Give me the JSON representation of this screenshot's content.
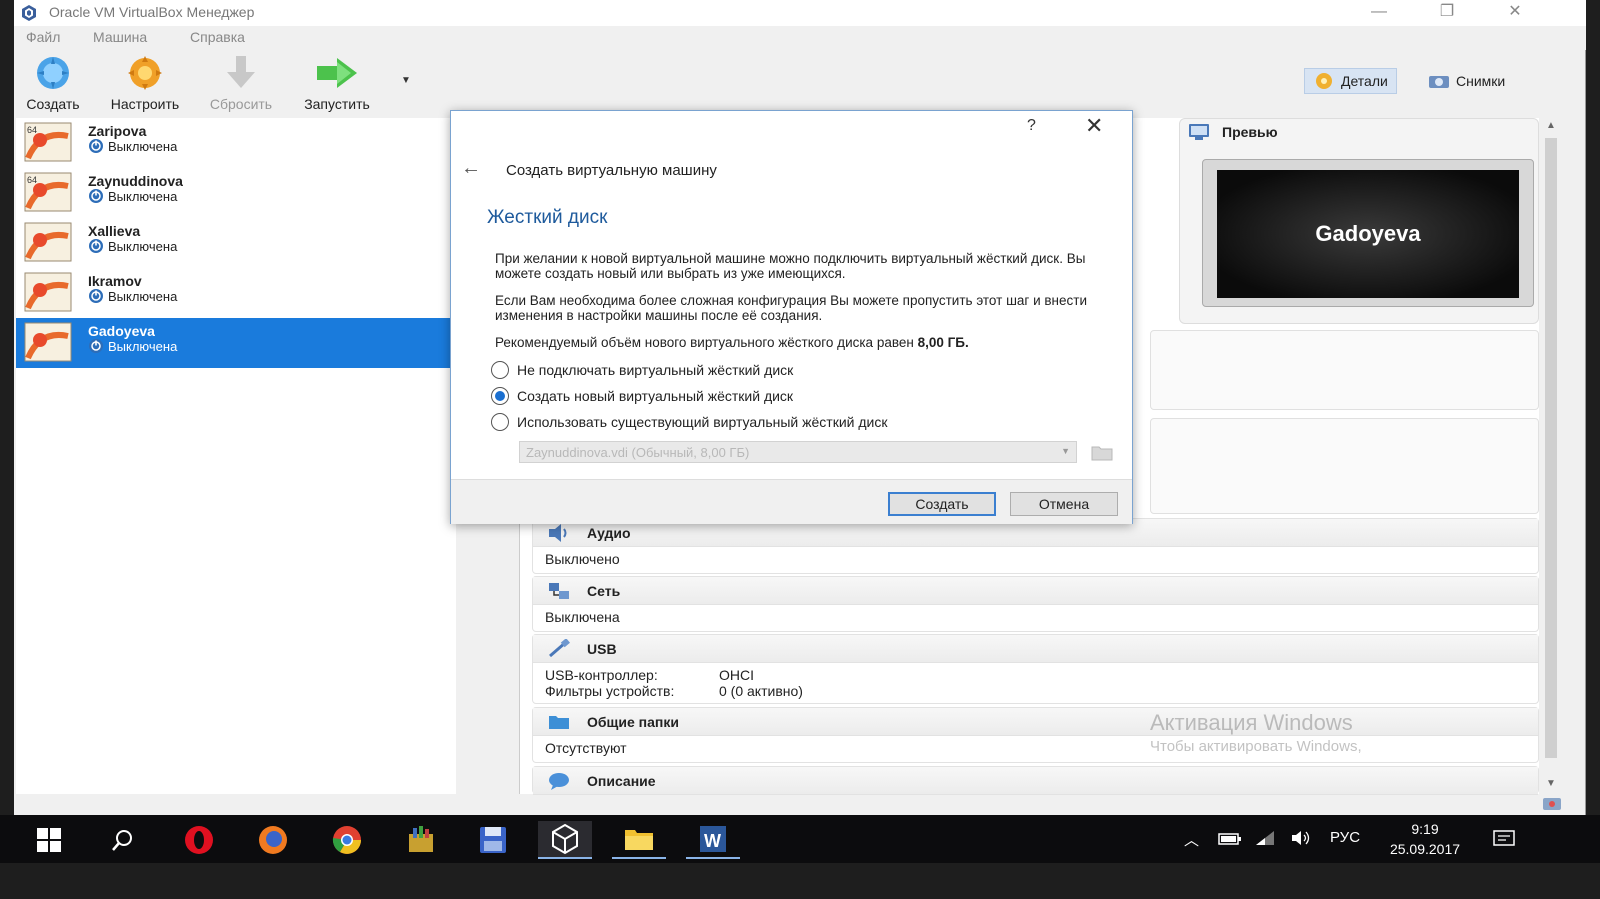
{
  "window": {
    "title": "Oracle VM VirtualBox Менеджер",
    "controls": {
      "minimize": "—",
      "restore": "❐",
      "close": "✕"
    }
  },
  "menu": [
    "Файл",
    "Машина",
    "Справка"
  ],
  "toolbar": {
    "create": "Создать",
    "settings": "Настроить",
    "discard": "Сбросить",
    "start": "Запустить",
    "details": "Детали",
    "snapshots": "Снимки"
  },
  "vms": [
    {
      "name": "Zaripova",
      "state": "Выключена",
      "badge": "64"
    },
    {
      "name": "Zaynuddinova",
      "state": "Выключена",
      "badge": "64"
    },
    {
      "name": "Xallieva",
      "state": "Выключена",
      "badge": ""
    },
    {
      "name": "Ikramov",
      "state": "Выключена",
      "badge": ""
    },
    {
      "name": "Gadoyeva",
      "state": "Выключена",
      "badge": ""
    }
  ],
  "preview": {
    "title": "Превью",
    "screen_text": "Gadoyeva"
  },
  "sections": {
    "audio": {
      "title": "Аудио",
      "value": "Выключено"
    },
    "network": {
      "title": "Сеть",
      "value": "Выключена"
    },
    "usb": {
      "title": "USB",
      "controller_label": "USB-контроллер:",
      "controller_value": "OHCI",
      "filters_label": "Фильтры устройств:",
      "filters_value": "0 (0 активно)"
    },
    "shared": {
      "title": "Общие папки",
      "value": "Отсутствуют"
    },
    "description": {
      "title": "Описание"
    }
  },
  "watermark": {
    "line1": "Активация Windows",
    "line2": "Чтобы активировать Windows,"
  },
  "dialog": {
    "help": "?",
    "close": "✕",
    "title": "Создать виртуальную машину",
    "heading": "Жесткий диск",
    "para1": "При желании к новой виртуальной машине можно подключить виртуальный жёсткий диск. Вы можете создать новый или выбрать из уже имеющихся.",
    "para2": "Если Вам необходима более сложная конфигурация Вы можете пропустить этот шаг и внести изменения в настройки машины после её создания.",
    "para3_prefix": "Рекомендуемый объём нового виртуального жёсткого диска равен ",
    "para3_size": "8,00 ГБ.",
    "options": [
      {
        "label": "Не подключать виртуальный жёсткий диск",
        "checked": false
      },
      {
        "label": "Создать новый виртуальный жёсткий диск",
        "checked": true
      },
      {
        "label": "Использовать существующий виртуальный жёсткий диск",
        "checked": false
      }
    ],
    "disk_combo_value": "Zaynuddinova.vdi (Обычный, 8,00 ГБ)",
    "create_button": "Создать",
    "cancel_button": "Отмена"
  },
  "taskbar": {
    "language": "РУС",
    "time": "9:19",
    "date": "25.09.2017"
  },
  "colors": {
    "selection": "#1a7bdc",
    "dialog_heading": "#1e5a9c",
    "taskbar": "#0c0c0e"
  }
}
